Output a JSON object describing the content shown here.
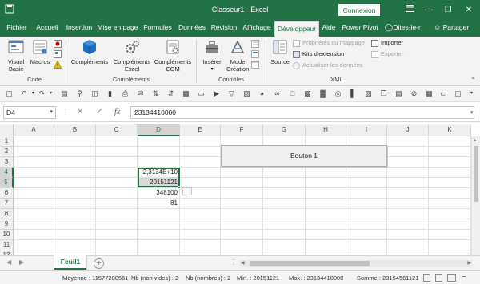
{
  "window": {
    "title": "Classeur1  -  Excel",
    "connexion_label": "Connexion",
    "min_glyph": "—",
    "restore_glyph": "❐",
    "close_glyph": "✕"
  },
  "tabs": [
    "Fichier",
    "Accueil",
    "Insertion",
    "Mise en page",
    "Formules",
    "Données",
    "Révision",
    "Affichage",
    "Développeur",
    "Aide",
    "Power Pivot"
  ],
  "active_tab": "Développeur",
  "tell_me": "Dites-le-r",
  "share": "Partager",
  "ribbon": {
    "code": {
      "label": "Code",
      "visual_basic": [
        "Visual",
        "Basic"
      ],
      "macros": "Macros"
    },
    "complements": {
      "label": "Compléments",
      "complements": "Compléments",
      "excel": [
        "Compléments",
        "Excel"
      ],
      "com": [
        "Compléments",
        "COM"
      ]
    },
    "controles": {
      "label": "Contrôles",
      "inserer": "Insérer",
      "mode": [
        "Mode",
        "Création"
      ]
    },
    "xml": {
      "label": "XML",
      "source": "Source",
      "proprietes": "Propriétés du mappage",
      "kits": "Kits d'extension",
      "actualiser": "Actualiser les données",
      "importer": "Importer",
      "exporter": "Exporter"
    }
  },
  "formula_bar": {
    "name_box": "D4",
    "cancel_glyph": "✕",
    "enter_glyph": "✓",
    "fx": "fx",
    "value": "23134410000"
  },
  "columns": [
    "A",
    "B",
    "C",
    "D",
    "E",
    "F",
    "G",
    "H",
    "I",
    "J",
    "K"
  ],
  "rows": [
    "1",
    "2",
    "3",
    "4",
    "5",
    "6",
    "7",
    "8",
    "9",
    "10",
    "11",
    "12"
  ],
  "cells": {
    "D4": "2,3134E+10",
    "D5": "20151121",
    "D6": "348100",
    "D7": "81"
  },
  "form_button": "Bouton 1",
  "sheet_tab": "Feuil1",
  "status": {
    "moyenne": "Moyenne : 11577280561",
    "nb_non_vides": "Nb (non vides) : 2",
    "nb_nombres": "Nb (nombres) : 2",
    "min": "Min. : 20151121",
    "max": "Max. : 23134410000",
    "somme": "Somme : 23154561121"
  },
  "colors": {
    "excel_green": "#217346",
    "ribbon_bg": "#f3f3f3",
    "selection_fill": "#d9d9d9"
  }
}
